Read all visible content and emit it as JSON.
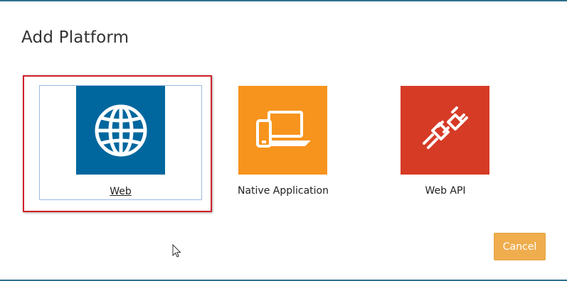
{
  "dialog": {
    "title": "Add Platform"
  },
  "platforms": [
    {
      "label": "Web",
      "icon": "globe-icon",
      "color": "#00679e",
      "selected": true
    },
    {
      "label": "Native Application",
      "icon": "devices-icon",
      "color": "#f7941d"
    },
    {
      "label": "Web API",
      "icon": "plug-icon",
      "color": "#d63b26"
    }
  ],
  "buttons": {
    "cancel_label": "Cancel"
  },
  "colors": {
    "selection_outline": "#d0202a",
    "cancel_bg": "#f0ad4e"
  }
}
